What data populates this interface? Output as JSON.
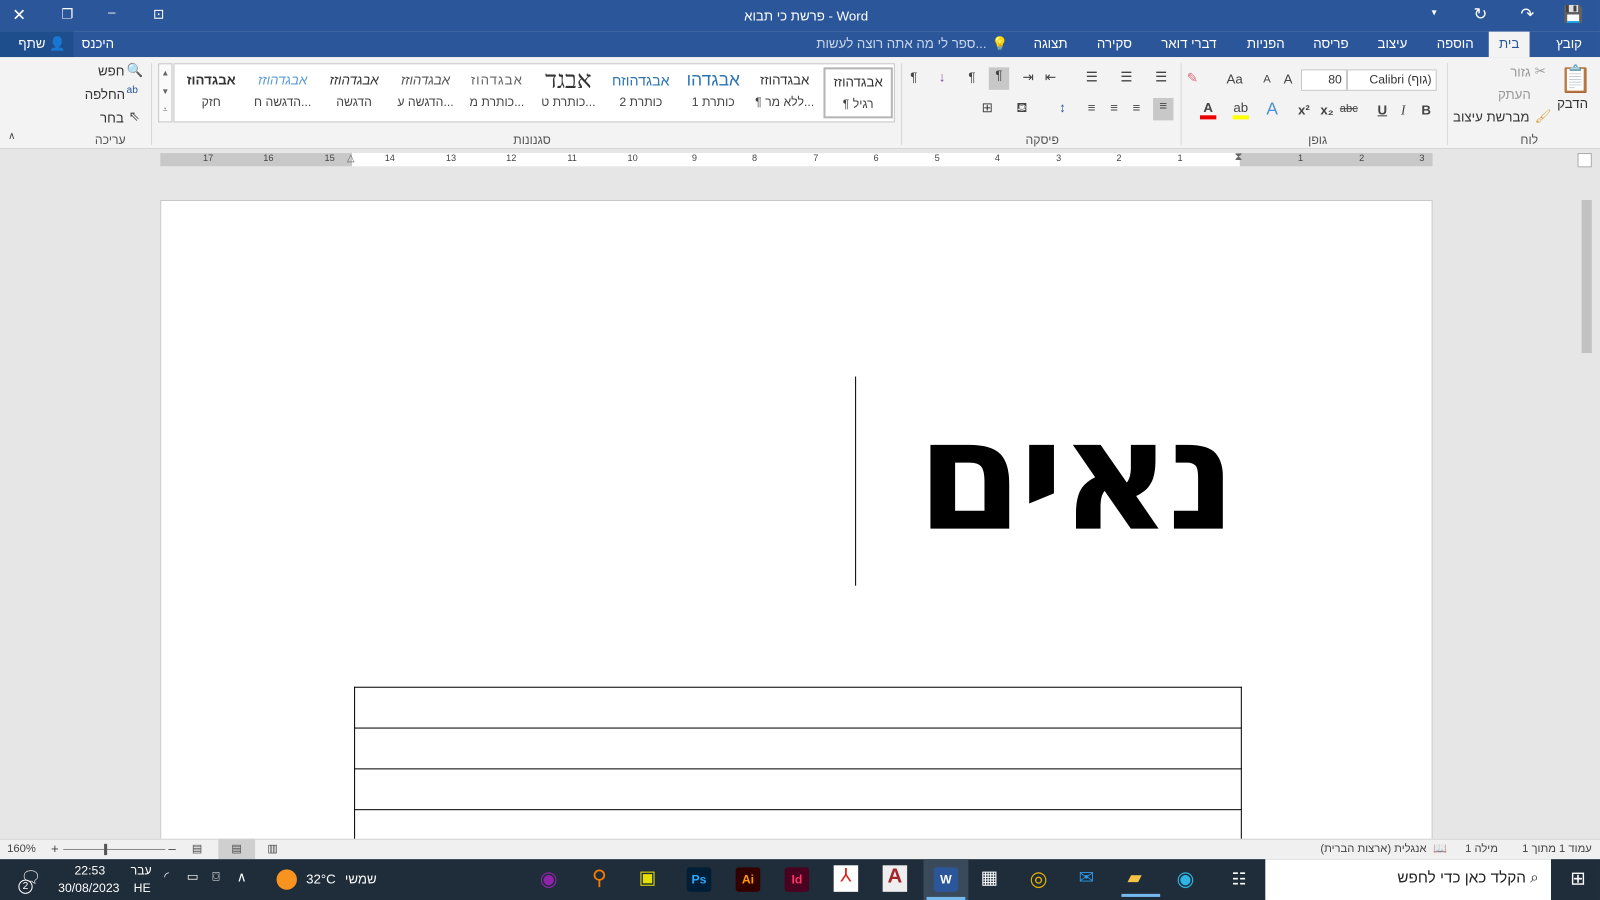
{
  "window": {
    "title": "פרשת כי תבוא - Word",
    "sign_in": "היכנס",
    "share": "שתף"
  },
  "tabs": [
    {
      "label": "קובץ"
    },
    {
      "label": "בית",
      "active": true
    },
    {
      "label": "הוספה"
    },
    {
      "label": "עיצוב"
    },
    {
      "label": "פריסה"
    },
    {
      "label": "הפניות"
    },
    {
      "label": "דברי דואר"
    },
    {
      "label": "סקירה"
    },
    {
      "label": "תצוגה"
    }
  ],
  "tell_me": "ספר לי מה אתה רוצה לעשות...",
  "clipboard": {
    "paste": "הדבק",
    "cut": "גזור",
    "copy": "העתק",
    "format_painter": "מברשת עיצוב",
    "label": "לוח"
  },
  "font": {
    "name": "Calibri (גוף)",
    "size": "80",
    "label": "גופן",
    "grow": "A",
    "shrink": "A",
    "case": "Aa",
    "bold": "B",
    "italic": "I",
    "underline": "U",
    "strike": "abc",
    "sub": "x₂",
    "sup": "x²"
  },
  "paragraph": {
    "label": "פיסקה"
  },
  "styles": {
    "label": "סגנונות",
    "items": [
      {
        "preview": "אבגדהוזז",
        "name": "¶ רגיל"
      },
      {
        "preview": "אבגדהוזז",
        "name": "¶ ללא מר..."
      },
      {
        "preview": "אבגדהו",
        "name": "כותרת 1"
      },
      {
        "preview": "אבגדהוזח",
        "name": "כותרת 2"
      },
      {
        "preview": "אבגד",
        "name": "כותרת ט..."
      },
      {
        "preview": "אבגדהוז",
        "name": "כותרת מ..."
      },
      {
        "preview": "אבגדהוזז",
        "name": "הדגשה ע..."
      },
      {
        "preview": "אבגדהוזז",
        "name": "הדגשה"
      },
      {
        "preview": "אבגדהוזז",
        "name": "הדגשה ח..."
      },
      {
        "preview": "אבגדהוז",
        "name": "חזק"
      }
    ]
  },
  "editing": {
    "find": "חפש",
    "replace": "החלפה",
    "select": "בחר",
    "label": "עריכה"
  },
  "ruler": {
    "right": [
      "1",
      "2",
      "3"
    ],
    "left": [
      "1",
      "2",
      "3",
      "4",
      "5",
      "6",
      "7",
      "8",
      "9",
      "10",
      "11",
      "12",
      "13",
      "14",
      "15",
      "16",
      "17"
    ]
  },
  "document": {
    "heading": "נאים",
    "table_rows": 4
  },
  "status": {
    "page": "עמוד 1 מתוך 1",
    "words": "מילה 1",
    "language": "אנגלית (ארצות הברית)",
    "zoom": "160%",
    "zoom_percent": 160
  },
  "taskbar": {
    "search": "הקלד כאן כדי לחפש",
    "weather_temp": "32°C",
    "weather_desc": "שמשי",
    "time": "22:53",
    "date": "30/08/2023",
    "lang1": "עבר",
    "lang2": "HE",
    "notifications": "2",
    "apps": [
      {
        "label": "Ps",
        "color": "#001e36",
        "fg": "#31a8ff"
      },
      {
        "label": "Ai",
        "color": "#330000",
        "fg": "#ff9a00"
      },
      {
        "label": "Id",
        "color": "#49021f",
        "fg": "#ff3366"
      },
      {
        "label": "W",
        "color": "#2b579a",
        "fg": "#ffffff"
      }
    ]
  }
}
